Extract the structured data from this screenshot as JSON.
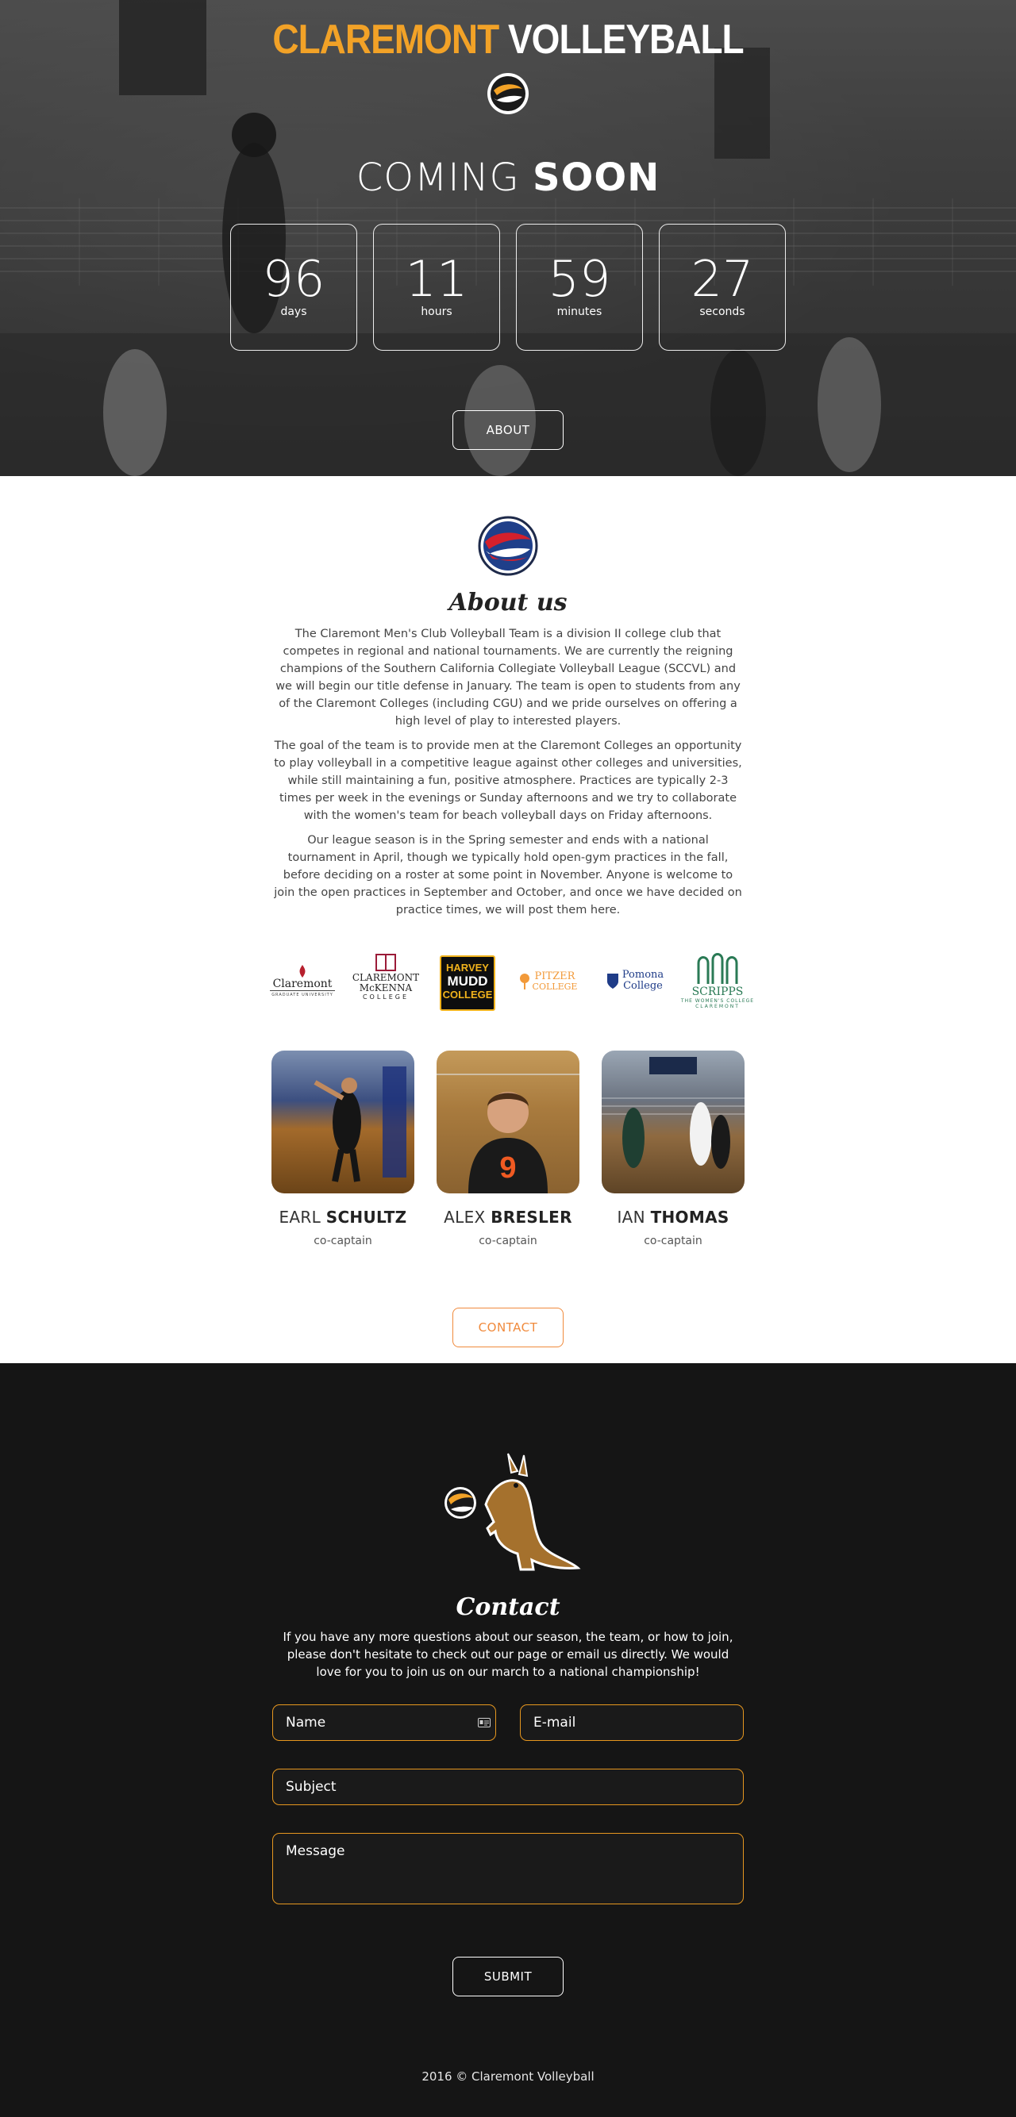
{
  "hero": {
    "brand_part1": "CLAREMONT",
    "brand_part2": "VOLLEYBALL",
    "coming_light": "COMING",
    "coming_bold": "SOON",
    "countdown": [
      {
        "value": "96",
        "label": "days"
      },
      {
        "value": "11",
        "label": "hours"
      },
      {
        "value": "59",
        "label": "minutes"
      },
      {
        "value": "27",
        "label": "seconds"
      }
    ],
    "about_button": "ABOUT",
    "accent_color": "#f2a227"
  },
  "about": {
    "title": "About us",
    "paragraphs": [
      "The Claremont Men's Club Volleyball Team is a division II college club that competes in regional and national tournaments. We are currently the reigning champions of the Southern California Collegiate Volleyball League (SCCVL) and we will begin our title defense in January. The team is open to students from any of the Claremont Colleges (including CGU) and we pride ourselves on offering a high level of play to interested players.",
      "The goal of the team is to provide men at the Claremont Colleges an opportunity to play volleyball in a competitive league against other colleges and universities, while still maintaining a fun, positive atmosphere. Practices are typically 2-3 times per week in the evenings or Sunday afternoons and we try to collaborate with the women's team for beach volleyball days on Friday afternoons.",
      "Our league season is in the Spring semester and ends with a national tournament in April, though we typically hold open-gym practices in the fall, before deciding on a roster at some point in November. Anyone is welcome to join the open practices in September and October, and once we have decided on practice times, we will post them here."
    ],
    "colleges": {
      "cgu_main": "Claremont",
      "cgu_sub": "GRADUATE UNIVERSITY",
      "cmc_1": "CLAREMONT",
      "cmc_2": "McKENNA",
      "cmc_3": "COLLEGE",
      "hmc_1": "HARVEY",
      "hmc_2": "MUDD",
      "hmc_3": "COLLEGE",
      "pitzer_1": "PITZER",
      "pitzer_2": "COLLEGE",
      "pomona_1": "Pomona",
      "pomona_2": "College",
      "scripps_1": "SCRIPPS",
      "scripps_2": "THE WOMEN'S COLLEGE",
      "scripps_3": "CLAREMONT"
    },
    "members": [
      {
        "first": "EARL",
        "last": "SCHULTZ",
        "role": "co-captain"
      },
      {
        "first": "ALEX",
        "last": "BRESLER",
        "role": "co-captain",
        "jersey": "9"
      },
      {
        "first": "IAN",
        "last": "THOMAS",
        "role": "co-captain"
      }
    ],
    "contact_button": "CONTACT",
    "contact_button_color": "#f08a3c"
  },
  "contact": {
    "title": "Contact",
    "text": "If you have any more questions about our season, the team, or how to join, please don't hesitate to check out our page or email us directly. We would love for you to join us on our march to a national championship!",
    "name_placeholder": "Name",
    "email_placeholder": "E-mail",
    "subject_placeholder": "Subject",
    "message_placeholder": "Message",
    "submit_button": "SUBMIT",
    "field_border_color": "#e6971f",
    "footer": "2016 © Claremont Volleyball"
  }
}
